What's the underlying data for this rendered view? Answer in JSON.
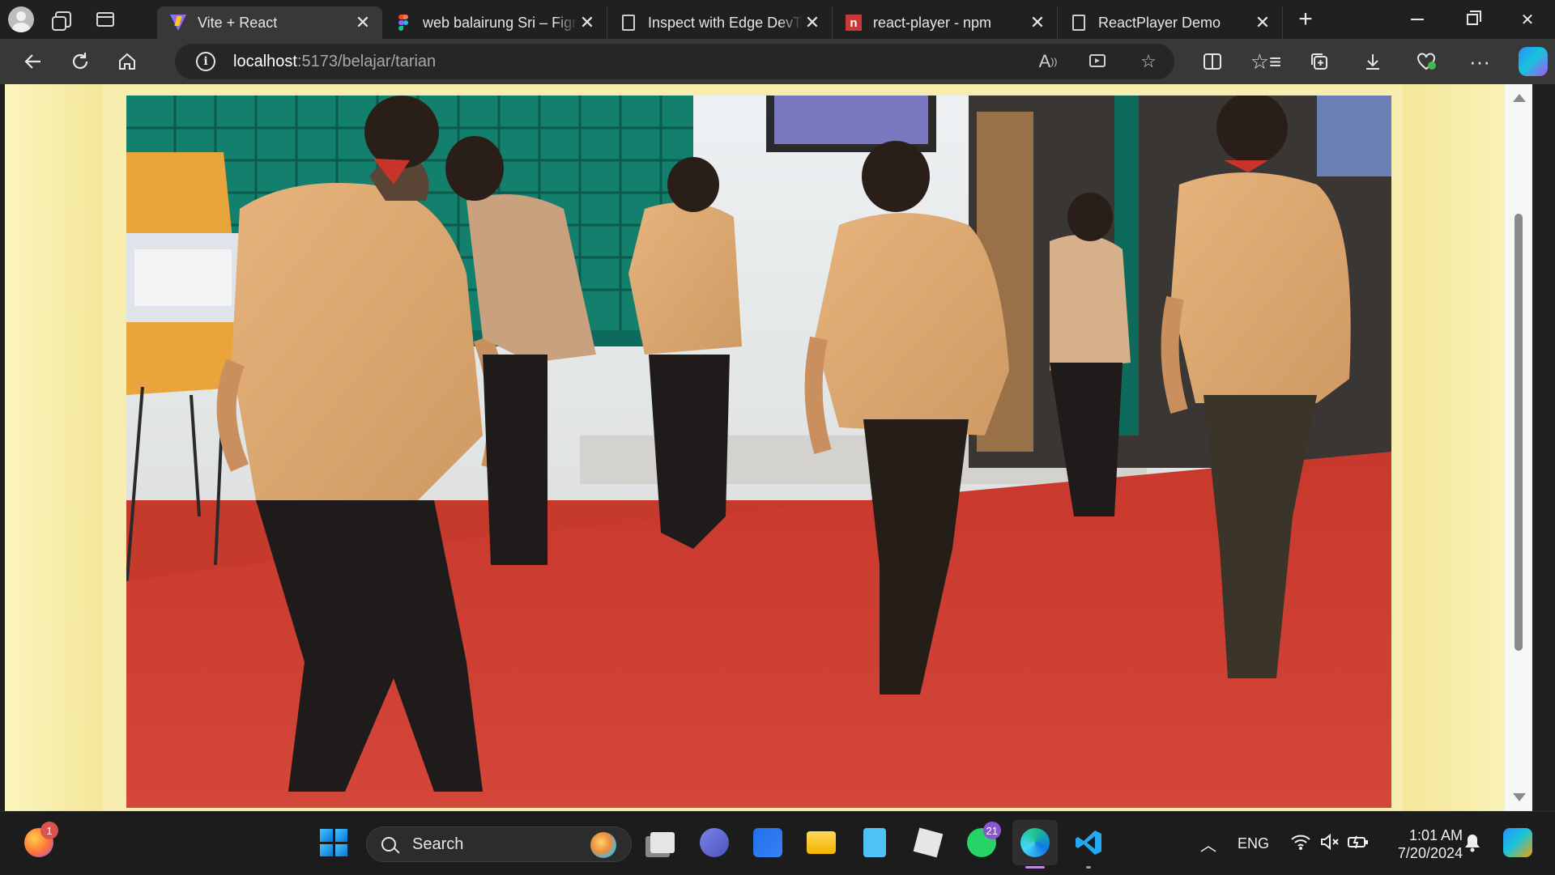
{
  "browser": {
    "tabs": [
      {
        "title": "Vite + React",
        "favicon": "vite-icon",
        "active": true
      },
      {
        "title": "web balairung Sri – Figma",
        "favicon": "figma-icon",
        "active": false
      },
      {
        "title": "Inspect with Edge DevTools",
        "favicon": "document-icon",
        "active": false
      },
      {
        "title": "react-player - npm",
        "favicon": "npm-icon",
        "active": false
      },
      {
        "title": "ReactPlayer Demo",
        "favicon": "document-icon",
        "active": false
      }
    ],
    "npm_letter": "n",
    "url_host": "localhost",
    "url_path": ":5173/belajar/tarian"
  },
  "page": {
    "background_color": "#fbf2b4",
    "video_description_colors": {
      "carpet": "#c63a2c",
      "shirt": "#e2ac74",
      "wall_green": "#137e6b"
    }
  },
  "taskbar": {
    "search_label": "Search",
    "firefox_badge": "1",
    "whatsapp_badge": "21",
    "language": "ENG",
    "time": "1:01 AM",
    "date": "7/20/2024"
  }
}
